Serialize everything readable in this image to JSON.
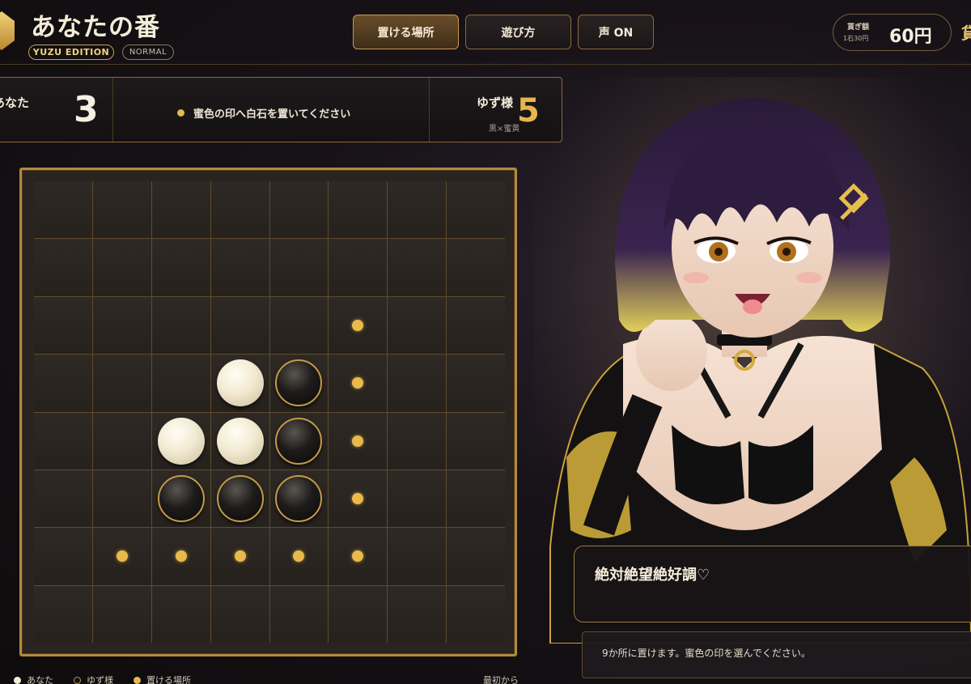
{
  "header": {
    "title": "あなたの番",
    "edition": "YUZU EDITION",
    "mode": "NORMAL",
    "buttons": {
      "placeable": "置ける場所",
      "howto": "遊び方",
      "voice": "声 ON"
    },
    "money": {
      "label": "貰ぎ額",
      "rate": "1石30円",
      "amount": "60円"
    },
    "cut_text": "貸"
  },
  "scoreboard": {
    "player_name": "あなた",
    "player_score": "3",
    "message": "蜜色の印へ白石を置いてください",
    "opponent_name": "ゆず様",
    "opponent_sub": "黒×蜜黄",
    "opponent_score": "5"
  },
  "board": {
    "cells": [
      "........",
      "........",
      ".....*..",
      "...WB*..",
      "..WWB*..",
      "..BBB*..",
      ".*****..",
      "........"
    ]
  },
  "legend": {
    "you": "あなた",
    "yuzu": "ゆず様",
    "placeable": "置ける場所",
    "reset": "最初から"
  },
  "dialog": {
    "speech": "絶対絶望絶好調♡",
    "info": "9か所に置けます。蜜色の印を選んでください。"
  },
  "colors": {
    "accent_gold": "#e4b84e",
    "frame_gold": "#b38a3e",
    "background": "#171217"
  },
  "icons": {
    "logo": "honeycomb-hexagon-icon",
    "message": "gold-dot-icon"
  }
}
